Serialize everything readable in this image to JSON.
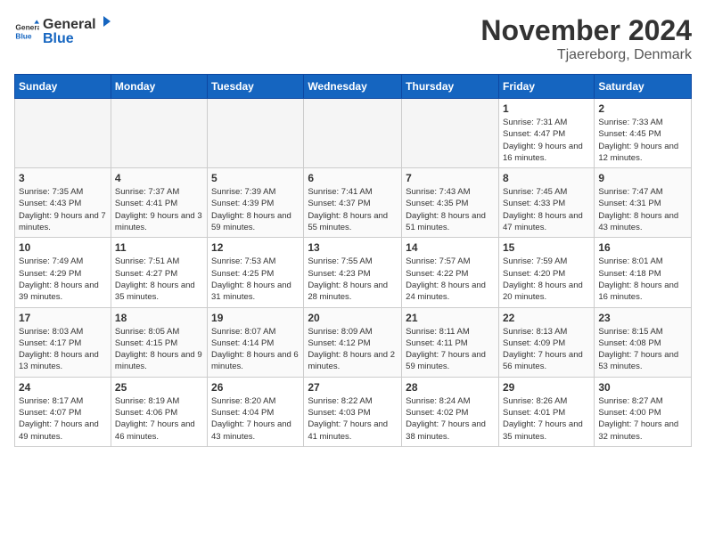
{
  "header": {
    "logo_general": "General",
    "logo_blue": "Blue",
    "month_title": "November 2024",
    "location": "Tjaereborg, Denmark"
  },
  "weekdays": [
    "Sunday",
    "Monday",
    "Tuesday",
    "Wednesday",
    "Thursday",
    "Friday",
    "Saturday"
  ],
  "weeks": [
    [
      {
        "day": "",
        "info": ""
      },
      {
        "day": "",
        "info": ""
      },
      {
        "day": "",
        "info": ""
      },
      {
        "day": "",
        "info": ""
      },
      {
        "day": "",
        "info": ""
      },
      {
        "day": "1",
        "info": "Sunrise: 7:31 AM\nSunset: 4:47 PM\nDaylight: 9 hours and 16 minutes."
      },
      {
        "day": "2",
        "info": "Sunrise: 7:33 AM\nSunset: 4:45 PM\nDaylight: 9 hours and 12 minutes."
      }
    ],
    [
      {
        "day": "3",
        "info": "Sunrise: 7:35 AM\nSunset: 4:43 PM\nDaylight: 9 hours and 7 minutes."
      },
      {
        "day": "4",
        "info": "Sunrise: 7:37 AM\nSunset: 4:41 PM\nDaylight: 9 hours and 3 minutes."
      },
      {
        "day": "5",
        "info": "Sunrise: 7:39 AM\nSunset: 4:39 PM\nDaylight: 8 hours and 59 minutes."
      },
      {
        "day": "6",
        "info": "Sunrise: 7:41 AM\nSunset: 4:37 PM\nDaylight: 8 hours and 55 minutes."
      },
      {
        "day": "7",
        "info": "Sunrise: 7:43 AM\nSunset: 4:35 PM\nDaylight: 8 hours and 51 minutes."
      },
      {
        "day": "8",
        "info": "Sunrise: 7:45 AM\nSunset: 4:33 PM\nDaylight: 8 hours and 47 minutes."
      },
      {
        "day": "9",
        "info": "Sunrise: 7:47 AM\nSunset: 4:31 PM\nDaylight: 8 hours and 43 minutes."
      }
    ],
    [
      {
        "day": "10",
        "info": "Sunrise: 7:49 AM\nSunset: 4:29 PM\nDaylight: 8 hours and 39 minutes."
      },
      {
        "day": "11",
        "info": "Sunrise: 7:51 AM\nSunset: 4:27 PM\nDaylight: 8 hours and 35 minutes."
      },
      {
        "day": "12",
        "info": "Sunrise: 7:53 AM\nSunset: 4:25 PM\nDaylight: 8 hours and 31 minutes."
      },
      {
        "day": "13",
        "info": "Sunrise: 7:55 AM\nSunset: 4:23 PM\nDaylight: 8 hours and 28 minutes."
      },
      {
        "day": "14",
        "info": "Sunrise: 7:57 AM\nSunset: 4:22 PM\nDaylight: 8 hours and 24 minutes."
      },
      {
        "day": "15",
        "info": "Sunrise: 7:59 AM\nSunset: 4:20 PM\nDaylight: 8 hours and 20 minutes."
      },
      {
        "day": "16",
        "info": "Sunrise: 8:01 AM\nSunset: 4:18 PM\nDaylight: 8 hours and 16 minutes."
      }
    ],
    [
      {
        "day": "17",
        "info": "Sunrise: 8:03 AM\nSunset: 4:17 PM\nDaylight: 8 hours and 13 minutes."
      },
      {
        "day": "18",
        "info": "Sunrise: 8:05 AM\nSunset: 4:15 PM\nDaylight: 8 hours and 9 minutes."
      },
      {
        "day": "19",
        "info": "Sunrise: 8:07 AM\nSunset: 4:14 PM\nDaylight: 8 hours and 6 minutes."
      },
      {
        "day": "20",
        "info": "Sunrise: 8:09 AM\nSunset: 4:12 PM\nDaylight: 8 hours and 2 minutes."
      },
      {
        "day": "21",
        "info": "Sunrise: 8:11 AM\nSunset: 4:11 PM\nDaylight: 7 hours and 59 minutes."
      },
      {
        "day": "22",
        "info": "Sunrise: 8:13 AM\nSunset: 4:09 PM\nDaylight: 7 hours and 56 minutes."
      },
      {
        "day": "23",
        "info": "Sunrise: 8:15 AM\nSunset: 4:08 PM\nDaylight: 7 hours and 53 minutes."
      }
    ],
    [
      {
        "day": "24",
        "info": "Sunrise: 8:17 AM\nSunset: 4:07 PM\nDaylight: 7 hours and 49 minutes."
      },
      {
        "day": "25",
        "info": "Sunrise: 8:19 AM\nSunset: 4:06 PM\nDaylight: 7 hours and 46 minutes."
      },
      {
        "day": "26",
        "info": "Sunrise: 8:20 AM\nSunset: 4:04 PM\nDaylight: 7 hours and 43 minutes."
      },
      {
        "day": "27",
        "info": "Sunrise: 8:22 AM\nSunset: 4:03 PM\nDaylight: 7 hours and 41 minutes."
      },
      {
        "day": "28",
        "info": "Sunrise: 8:24 AM\nSunset: 4:02 PM\nDaylight: 7 hours and 38 minutes."
      },
      {
        "day": "29",
        "info": "Sunrise: 8:26 AM\nSunset: 4:01 PM\nDaylight: 7 hours and 35 minutes."
      },
      {
        "day": "30",
        "info": "Sunrise: 8:27 AM\nSunset: 4:00 PM\nDaylight: 7 hours and 32 minutes."
      }
    ]
  ]
}
